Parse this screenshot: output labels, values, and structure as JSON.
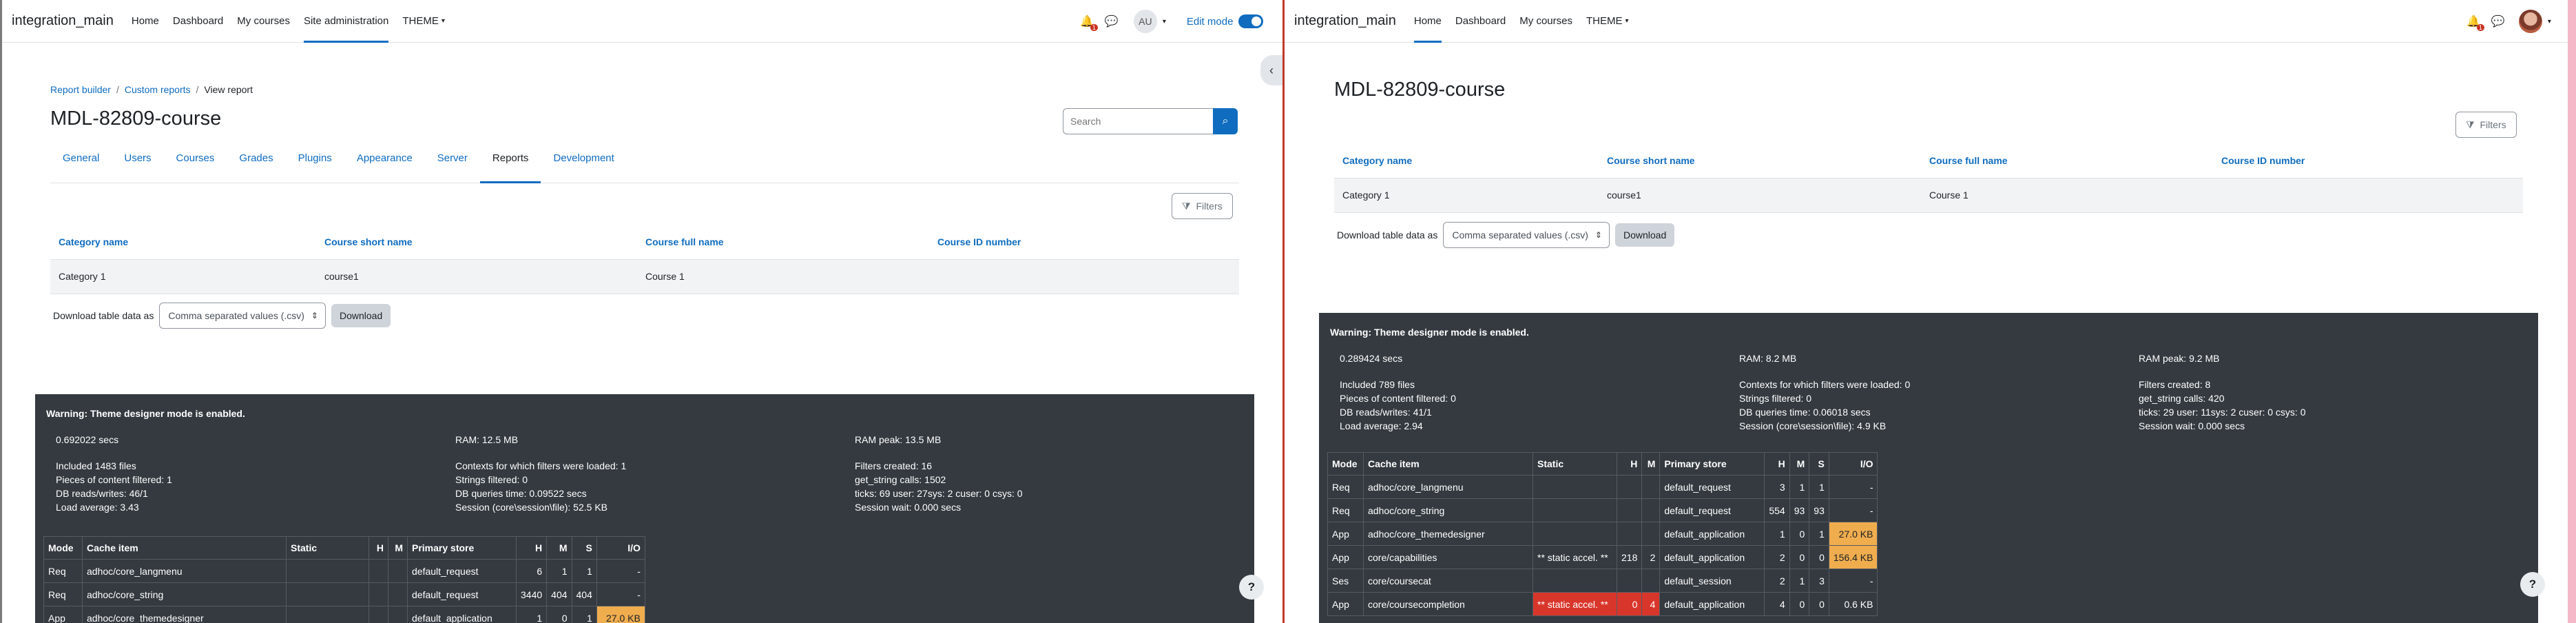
{
  "left": {
    "navbar": {
      "brand": "integration_main",
      "items": [
        "Home",
        "Dashboard",
        "My courses",
        "Site administration",
        "THEME"
      ],
      "active": "Site administration",
      "notification_count": "1",
      "avatar_initials": "AU",
      "edit_mode_label": "Edit mode",
      "edit_mode_on": true
    },
    "breadcrumb": [
      "Report builder",
      "Custom reports",
      "View report"
    ],
    "title": "MDL-82809-course",
    "search": {
      "placeholder": "Search"
    },
    "tabs": [
      "General",
      "Users",
      "Courses",
      "Grades",
      "Plugins",
      "Appearance",
      "Server",
      "Reports",
      "Development"
    ],
    "active_tab": "Reports",
    "filters_label": "Filters",
    "table": {
      "columns": [
        "Category name",
        "Course short name",
        "Course full name",
        "Course ID number"
      ],
      "rows": [
        [
          "Category 1",
          "course1",
          "Course 1",
          ""
        ]
      ]
    },
    "download": {
      "label": "Download table data as",
      "format": "Comma separated values (.csv)",
      "button": "Download"
    },
    "perf": {
      "warning": "Warning: Theme designer mode is enabled.",
      "col1": [
        "0.692022 secs",
        "Included 1483 files",
        "Pieces of content filtered: 1",
        "DB reads/writes: 46/1",
        "Load average: 3.43"
      ],
      "col2": [
        "RAM: 12.5 MB",
        "Contexts for which filters were loaded: 1",
        "Strings filtered: 0",
        "DB queries time: 0.09522 secs",
        "Session (core\\session\\file): 52.5 KB"
      ],
      "col3": [
        "RAM peak: 13.5 MB",
        "Filters created: 16",
        "get_string calls: 1502",
        "ticks: 69 user: 27sys: 2 cuser: 0 csys: 0",
        "Session wait: 0.000 secs"
      ],
      "cache_headers": [
        "Mode",
        "Cache item",
        "Static",
        "H",
        "M",
        "Primary store",
        "H",
        "M",
        "S",
        "I/O"
      ],
      "cache_rows": [
        [
          "Req",
          "adhoc/core_langmenu",
          "",
          "",
          "",
          "default_request",
          "6",
          "1",
          "1",
          "-"
        ],
        [
          "Req",
          "adhoc/core_string",
          "",
          "",
          "",
          "default_request",
          "3440",
          "404",
          "404",
          "-"
        ],
        [
          "App",
          "adhoc/core_themedesigner",
          "",
          "",
          "",
          "default_application",
          "1",
          "0",
          "1",
          "27.0 KB"
        ]
      ]
    }
  },
  "right": {
    "navbar": {
      "brand": "integration_main",
      "items": [
        "Home",
        "Dashboard",
        "My courses",
        "THEME"
      ],
      "active": "Home",
      "notification_count": "1"
    },
    "title": "MDL-82809-course",
    "filters_label": "Filters",
    "table": {
      "columns": [
        "Category name",
        "Course short name",
        "Course full name",
        "Course ID number"
      ],
      "rows": [
        [
          "Category 1",
          "course1",
          "Course 1",
          ""
        ]
      ]
    },
    "download": {
      "label": "Download table data as",
      "format": "Comma separated values (.csv)",
      "button": "Download"
    },
    "perf": {
      "warning": "Warning: Theme designer mode is enabled.",
      "col1": [
        "0.289424 secs",
        "Included 789 files",
        "Pieces of content filtered: 0",
        "DB reads/writes: 41/1",
        "Load average: 2.94"
      ],
      "col2": [
        "RAM: 8.2 MB",
        "Contexts for which filters were loaded: 0",
        "Strings filtered: 0",
        "DB queries time: 0.06018 secs",
        "Session (core\\session\\file): 4.9 KB"
      ],
      "col3": [
        "RAM peak: 9.2 MB",
        "Filters created: 8",
        "get_string calls: 420",
        "ticks: 29 user: 11sys: 2 cuser: 0 csys: 0",
        "Session wait: 0.000 secs"
      ],
      "cache_headers": [
        "Mode",
        "Cache item",
        "Static",
        "H",
        "M",
        "Primary store",
        "H",
        "M",
        "S",
        "I/O"
      ],
      "cache_rows": [
        [
          "Req",
          "adhoc/core_langmenu",
          "",
          "",
          "",
          "default_request",
          "3",
          "1",
          "1",
          "-"
        ],
        [
          "Req",
          "adhoc/core_string",
          "",
          "",
          "",
          "default_request",
          "554",
          "93",
          "93",
          "-"
        ],
        [
          "App",
          "adhoc/core_themedesigner",
          "",
          "",
          "",
          "default_application",
          "1",
          "0",
          "1",
          "27.0 KB"
        ],
        [
          "App",
          "core/capabilities",
          "** static accel. **",
          "218",
          "2",
          "default_application",
          "2",
          "0",
          "0",
          "156.4 KB"
        ],
        [
          "Ses",
          "core/coursecat",
          "",
          "",
          "",
          "default_session",
          "2",
          "1",
          "3",
          "-"
        ],
        [
          "App",
          "core/coursecompletion",
          "** static accel. **",
          "0",
          "4",
          "default_application",
          "4",
          "0",
          "0",
          "0.6 KB"
        ]
      ]
    }
  },
  "help_label": "?",
  "colors": {
    "accent": "#0f6cbf",
    "perf_bg": "#343a40",
    "io_highlight": "#f0ad4e",
    "static_miss": "#d9362b"
  }
}
